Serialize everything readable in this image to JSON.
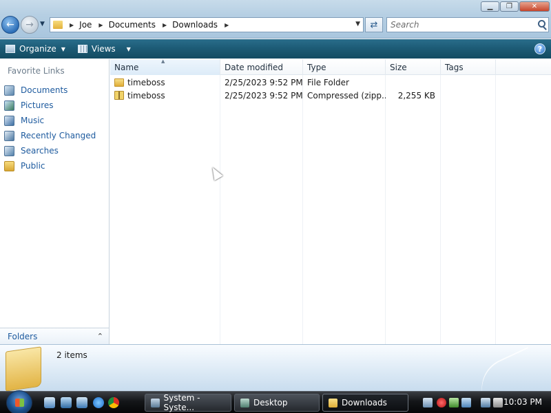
{
  "window": {
    "minimize_label": "▁",
    "maximize_label": "❐",
    "close_label": "✕"
  },
  "address": {
    "crumbs": [
      "Joe",
      "Documents",
      "Downloads"
    ]
  },
  "search": {
    "placeholder": "Search"
  },
  "toolbar": {
    "organize_label": "Organize",
    "views_label": "Views",
    "help_label": "?"
  },
  "navpane": {
    "title": "Favorite Links",
    "items": [
      {
        "label": "Documents",
        "icon": "documents-icon"
      },
      {
        "label": "Pictures",
        "icon": "pictures-icon"
      },
      {
        "label": "Music",
        "icon": "music-icon"
      },
      {
        "label": "Recently Changed",
        "icon": "recently-changed-icon"
      },
      {
        "label": "Searches",
        "icon": "searches-icon"
      },
      {
        "label": "Public",
        "icon": "public-folder-icon"
      }
    ],
    "folders_label": "Folders"
  },
  "filelist": {
    "columns": [
      "Name",
      "Date modified",
      "Type",
      "Size",
      "Tags"
    ],
    "rows": [
      {
        "name": "timeboss",
        "date": "2/25/2023 9:52 PM",
        "type": "File Folder",
        "size": "",
        "icon": "folder-icon"
      },
      {
        "name": "timeboss",
        "date": "2/25/2023 9:52 PM",
        "type": "Compressed (zipp...",
        "size": "2,255 KB",
        "icon": "zip-folder-icon"
      }
    ]
  },
  "details": {
    "count_text": "2 items"
  },
  "taskbar": {
    "tasks": [
      {
        "label": "System - Syste..."
      },
      {
        "label": "Desktop"
      },
      {
        "label": "Downloads"
      }
    ],
    "clock": "10:03 PM"
  }
}
